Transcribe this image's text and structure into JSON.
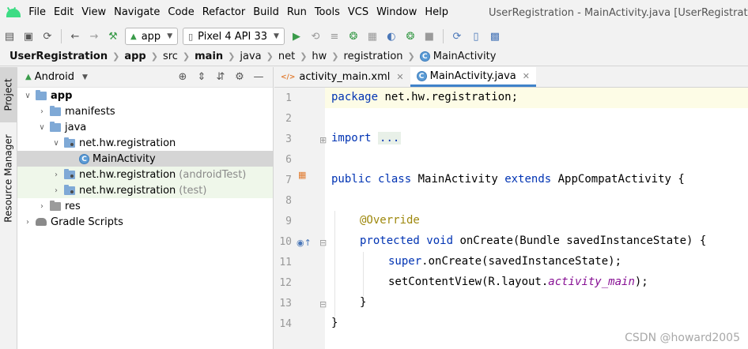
{
  "menubar": {
    "items": [
      "File",
      "Edit",
      "View",
      "Navigate",
      "Code",
      "Refactor",
      "Build",
      "Run",
      "Tools",
      "VCS",
      "Window",
      "Help"
    ],
    "window_title": "UserRegistration - MainActivity.java [UserRegistration.app.main]"
  },
  "toolbar": {
    "run_config": "app",
    "device": "Pixel 4 API 33"
  },
  "breadcrumb": {
    "items": [
      "UserRegistration",
      "app",
      "src",
      "main",
      "java",
      "net",
      "hw",
      "registration",
      "MainActivity"
    ]
  },
  "left_strip": {
    "project_tab": "Project",
    "resource_tab": "Resource Manager"
  },
  "project": {
    "view_mode": "Android",
    "tree": [
      {
        "label": "app",
        "suffix": ""
      },
      {
        "label": "manifests",
        "suffix": ""
      },
      {
        "label": "java",
        "suffix": ""
      },
      {
        "label": "net.hw.registration",
        "suffix": ""
      },
      {
        "label": "MainActivity",
        "suffix": ""
      },
      {
        "label": "net.hw.registration",
        "suffix": "(androidTest)"
      },
      {
        "label": "net.hw.registration",
        "suffix": "(test)"
      },
      {
        "label": "res",
        "suffix": ""
      },
      {
        "label": "Gradle Scripts",
        "suffix": ""
      }
    ]
  },
  "editor": {
    "tabs": [
      "activity_main.xml",
      "MainActivity.java"
    ],
    "active_tab": "MainActivity.java",
    "line_numbers": [
      "1",
      "2",
      "3",
      "6",
      "7",
      "8",
      "9",
      "10",
      "11",
      "12",
      "13",
      "14"
    ],
    "code": {
      "l1_kw": "package",
      "l1_rest": " net.hw.registration;",
      "l3_kw": "import",
      "l3_dots": "...",
      "l7_kw1": "public",
      "l7_kw2": "class",
      "l7_name": " MainActivity ",
      "l7_kw3": "extends",
      "l7_rest": " AppCompatActivity {",
      "l9_ann": "@Override",
      "l10_kw1": "protected",
      "l10_kw2": "void",
      "l10_rest": " onCreate(Bundle savedInstanceState) {",
      "l11_kw": "super",
      "l11_rest": ".onCreate(savedInstanceState);",
      "l12_a": "setContentView(R.layout.",
      "l12_b": "activity_main",
      "l12_c": ");",
      "l13": "}",
      "l14": "}"
    }
  },
  "watermark": "CSDN @howard2005",
  "colors": {
    "keyword": "#0033b3",
    "annotation": "#9e880d",
    "field_italic": "#871094",
    "active_tab_underline": "#4083c9",
    "android_green": "#3ddc84"
  }
}
